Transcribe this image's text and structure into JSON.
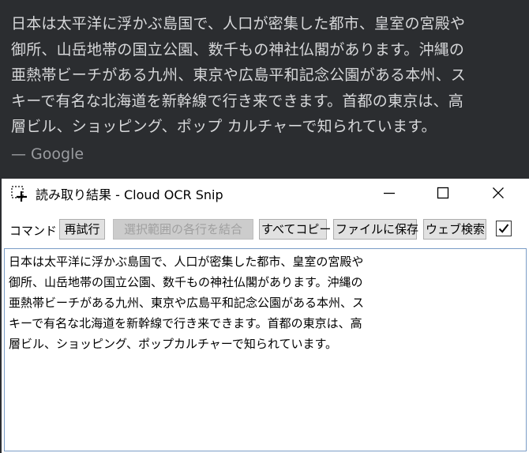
{
  "background": {
    "text_lines": [
      "日本は太平洋に浮かぶ島国で、人口が密集した都市、皇室の宮殿や",
      "御所、山岳地帯の国立公園、数千もの神社仏閣があります。沖縄の",
      "亜熱帯ビーチがある九州、東京や広島平和記念公園がある本州、ス",
      "キーで有名な北海道を新幹線で行き来できます。首都の東京は、高",
      "層ビル、ショッピング、ポップ カルチャーで知られています。"
    ],
    "source": "— Google"
  },
  "window": {
    "title": "読み取り結果 - Cloud OCR Snip",
    "icons": {
      "app": "crop-selection-icon",
      "minimize": "minimize-icon",
      "maximize": "maximize-icon",
      "close": "close-icon"
    }
  },
  "toolbar": {
    "label": "コマンド",
    "retry": "再試行",
    "join_lines": "選択範囲の各行を結合",
    "copy_all": "すべてコピー",
    "save_file": "ファイルに保存",
    "web_search": "ウェブ検索",
    "checkbox_checked": true
  },
  "result": {
    "lines": [
      "日本は太平洋に浮かぶ島国で、人口が密集した都市、皇室の宮殿や",
      "御所、山岳地帯の国立公園、数千もの神社仏閣があります。沖縄の",
      "亜熱帯ビーチがある九州、東京や広島平和記念公園がある本州、ス",
      "キーで有名な北海道を新幹線で行き来できます。首都の東京は、高",
      "層ビル、ショッピング、ポップカルチャーで知られています。"
    ]
  },
  "colors": {
    "page_background": "#2b2d30",
    "window_background": "#ffffff",
    "focus_border": "#7a9cc6"
  }
}
